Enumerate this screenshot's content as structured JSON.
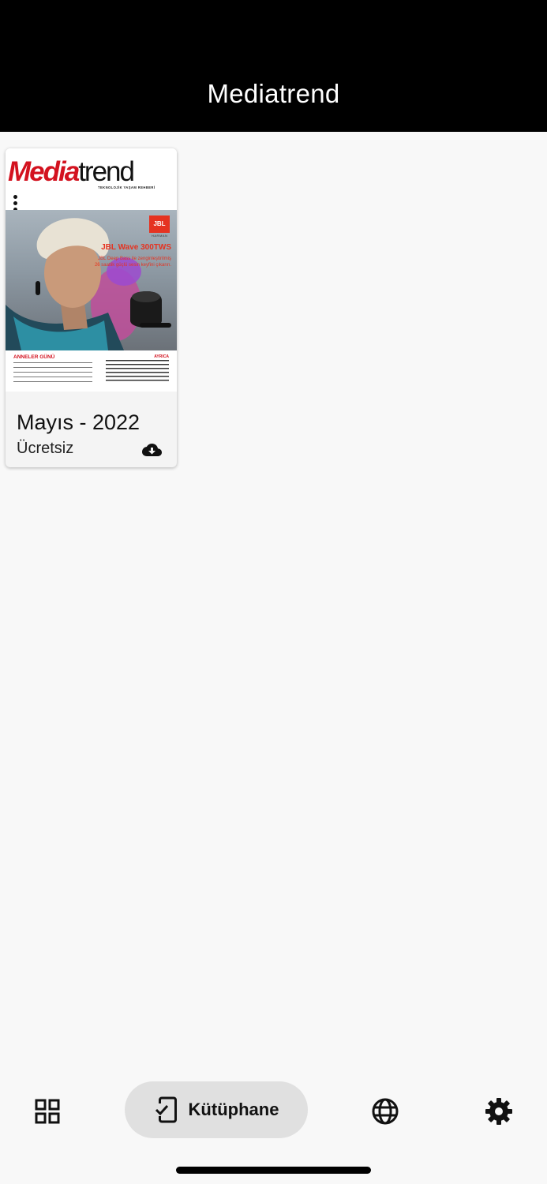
{
  "app_bar": {
    "title": "Mediatrend"
  },
  "issue_card": {
    "cover": {
      "logo_part1": "Media",
      "logo_part2": "trend",
      "slogan": "TEKNOLOJİK YAŞAM REHBERİ",
      "product_title": "JBL Wave 300TWS",
      "product_subtitle": "JBL Deep Bass ile zenginleştirilmiş 26 saatlik güçlü sesin keyfini çıkarın.",
      "brand_badge": "JBL",
      "brand_sub": "HARMAN",
      "footer_left_title": "ANNELER GÜNÜ",
      "footer_right_title": "AYRICA"
    },
    "title": "Mayıs - 2022",
    "price": "Ücretsiz",
    "download_icon": "cloud-download-icon"
  },
  "bottom_nav": {
    "items": [
      {
        "icon": "grid-icon",
        "label": ""
      },
      {
        "icon": "phone-check-icon",
        "label": "Kütüphane",
        "selected": true
      },
      {
        "icon": "globe-icon",
        "label": ""
      },
      {
        "icon": "gear-icon",
        "label": ""
      }
    ]
  },
  "colors": {
    "app_bar": "#000000",
    "brand_red": "#d3121f",
    "jbl_orange": "#e53321",
    "nav_selected_bg": "#e0e0e0"
  }
}
